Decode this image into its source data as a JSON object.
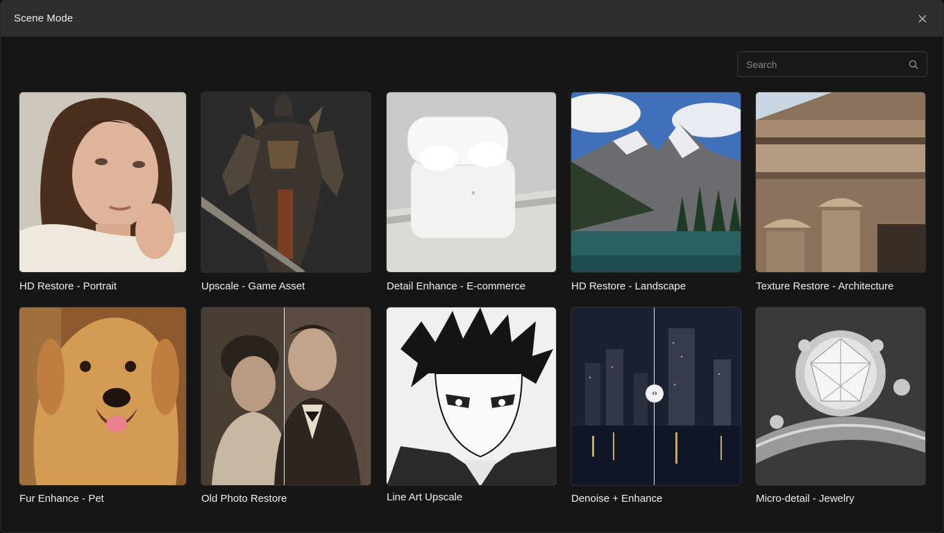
{
  "window": {
    "title": "Scene Mode"
  },
  "search": {
    "placeholder": "Search",
    "value": ""
  },
  "cards": [
    {
      "label": "HD Restore - Portrait"
    },
    {
      "label": "Upscale - Game Asset"
    },
    {
      "label": "Detail Enhance - E-commerce"
    },
    {
      "label": "HD Restore - Landscape"
    },
    {
      "label": "Texture Restore - Architecture"
    },
    {
      "label": "Fur Enhance - Pet"
    },
    {
      "label": "Old Photo Restore"
    },
    {
      "label": "Line Art Upscale"
    },
    {
      "label": "Denoise + Enhance"
    },
    {
      "label": "Micro-detail - Jewelry"
    }
  ],
  "colors": {
    "background": "#161616",
    "titlebar": "#2e2e2e",
    "text": "#f0f0f0"
  }
}
